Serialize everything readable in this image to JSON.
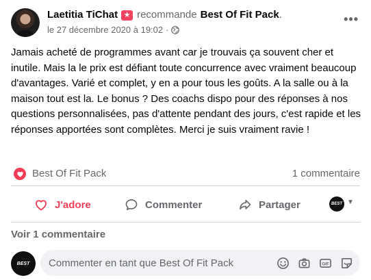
{
  "post": {
    "author_name": "Laetitia TiChat",
    "recommends_word": "recommande",
    "page_name": "Best Of Fit Pack",
    "page_name_end": ".",
    "date": "le 27 décembre 2020 à 19:02",
    "separator": "·",
    "more_label": "•••",
    "text": "Jamais acheté de programmes avant car je trouvais ça souvent cher et inutile. Mais la le prix est défiant toute concurrence avec vraiment beaucoup d'avantages. Varié et complet, y en a pour tous les goûts. A la salle ou à la maison tout est la. Le bonus ? Des coachs dispo pour des réponses à nos questions personnalisées, pas d'attente pendant des jours, c'est rapide et les réponses apportées sont complètes. Merci je suis vraiment ravie !"
  },
  "reactions": {
    "reactor": "Best Of Fit Pack",
    "comment_count": "1 commentaire"
  },
  "actions": {
    "love_label": "J'adore",
    "comment_label": "Commenter",
    "share_label": "Partager",
    "share_avatar_text": "BEST"
  },
  "comments": {
    "see_label": "Voir 1 commentaire",
    "avatar_text": "BEST",
    "placeholder": "Commenter en tant que Best Of Fit Pack",
    "gif_label": "GIF"
  },
  "colors": {
    "love": "#f33e58",
    "badge": "#f3425f",
    "secondary_text": "#65676b",
    "composer_bg": "#f0f2f5"
  }
}
